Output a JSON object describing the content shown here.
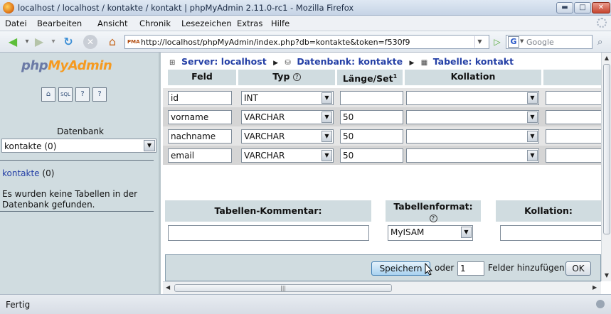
{
  "window": {
    "title": "localhost / localhost / kontakte / kontakt | phpMyAdmin 2.11.0-rc1 - Mozilla Firefox",
    "buttons": {
      "min": "▬",
      "max": "□",
      "close": "✕"
    }
  },
  "menu": [
    "Datei",
    "Bearbeiten",
    "Ansicht",
    "Chronik",
    "Lesezeichen",
    "Extras",
    "Hilfe"
  ],
  "nav": {
    "url": "http://localhost/phpMyAdmin/index.php?db=kontakte&token=f530f9",
    "favicon_text": "PMA",
    "search_engine_letter": "G",
    "search_placeholder": "Google",
    "icons": {
      "back": "back-arrow-icon",
      "forward": "forward-arrow-icon",
      "reload": "reload-icon",
      "stop": "stop-icon",
      "home": "home-icon"
    }
  },
  "sidebar": {
    "logo": {
      "php": "php",
      "my": "My",
      "admin": "Admin"
    },
    "icons": [
      "home-icon",
      "sql-query-icon",
      "documentation-icon",
      "sql-docs-icon"
    ],
    "icon_glyphs": [
      "⌂",
      "SQL",
      "?",
      "?"
    ],
    "db_label": "Datenbank",
    "db_select_value": "kontakte (0)",
    "db_link_name": "kontakte",
    "db_link_count": " (0)",
    "no_tables_text": "Es wurden keine Tabellen in der Datenbank gefunden."
  },
  "breadcrumb": {
    "server": "Server: localhost",
    "database": "Datenbank: kontakte",
    "table": "Tabelle: kontakt"
  },
  "table_headers": {
    "feld": "Feld",
    "typ": "Typ",
    "laenge": "Länge/Set",
    "laenge_sup": "1",
    "kollation": "Kollation"
  },
  "fields": [
    {
      "name": "id",
      "type": "INT",
      "length": ""
    },
    {
      "name": "vorname",
      "type": "VARCHAR",
      "length": "50"
    },
    {
      "name": "nachname",
      "type": "VARCHAR",
      "length": "50"
    },
    {
      "name": "email",
      "type": "VARCHAR",
      "length": "50"
    }
  ],
  "options": {
    "comment_label": "Tabellen-Kommentar:",
    "format_label": "Tabellenformat:",
    "format_value": "MyISAM",
    "collation_label": "Kollation:"
  },
  "footer": {
    "save_label": "Speichern",
    "oder": "oder",
    "add_count": "1",
    "add_fields_label": "Felder hinzufügen",
    "ok_label": "OK"
  },
  "status": {
    "text": "Fertig"
  },
  "colors": {
    "frame_bg": "#d0dce0",
    "link": "#2540a6",
    "logo_orange": "#f69a1f"
  }
}
